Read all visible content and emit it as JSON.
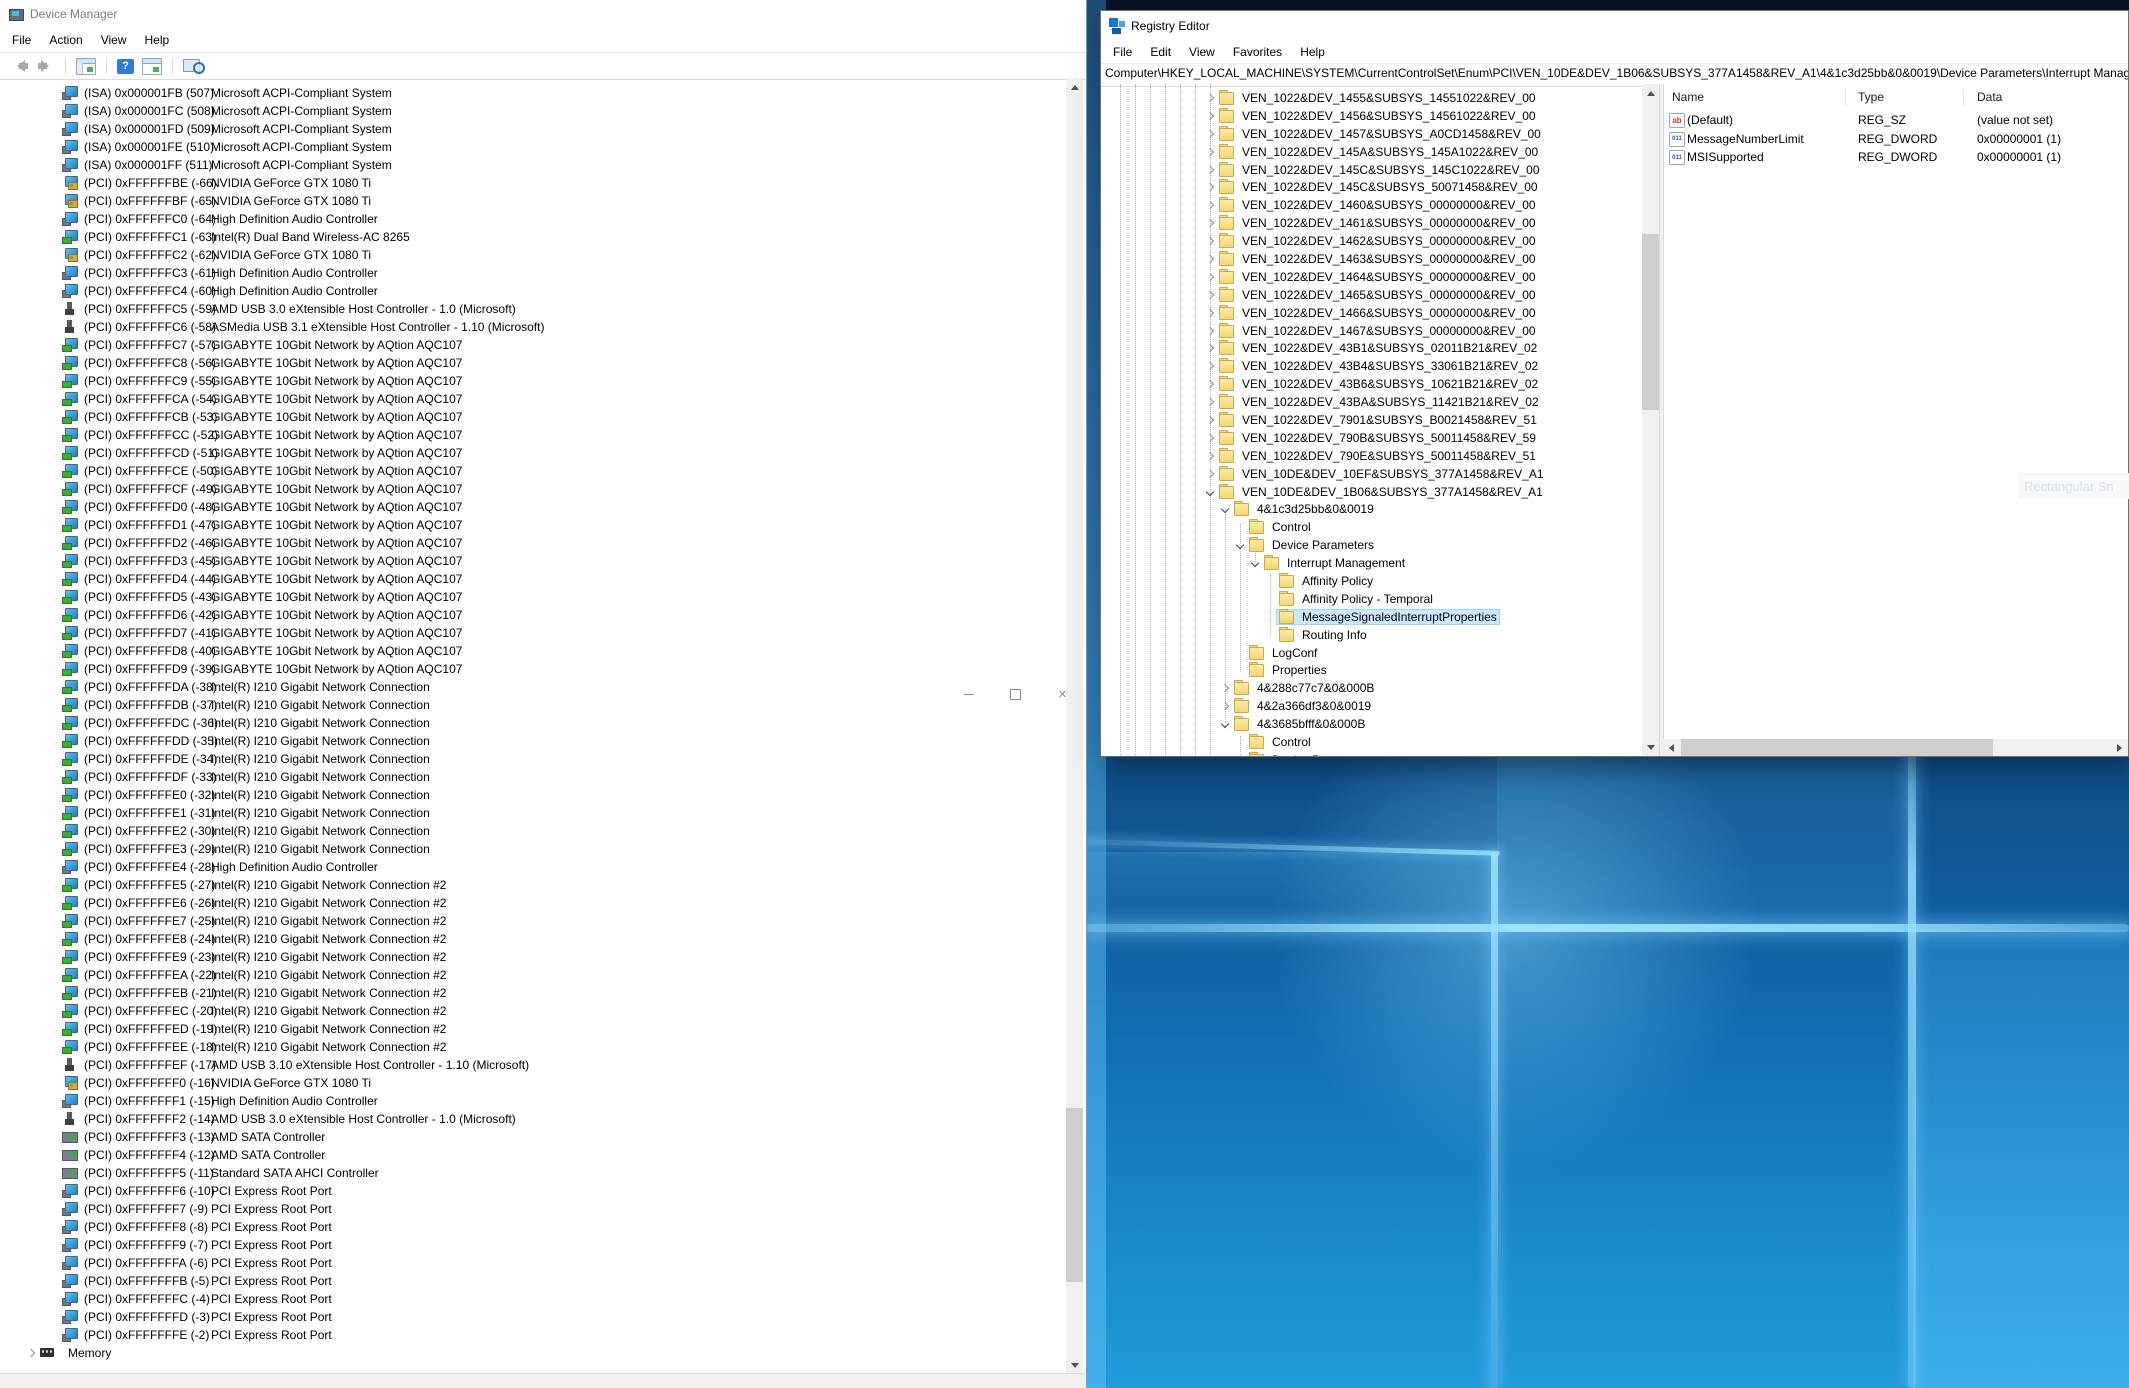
{
  "colors": {
    "selection": "#cce8ff",
    "folder": "#f6d672",
    "beam": "#9fe0ff",
    "wallpaper_top": "#061124",
    "wallpaper_bottom": "#219bdb",
    "chrome": "#ffffff"
  },
  "ghost": {
    "label": "Rectangular Sn"
  },
  "device_manager": {
    "title": "Device Manager",
    "menus": [
      "File",
      "Action",
      "View",
      "Help"
    ],
    "toolbar_icons": [
      "back",
      "forward",
      "show-console-tree",
      "help",
      "properties",
      "scan-hardware-changes"
    ],
    "memory_label": "Memory",
    "rows": [
      {
        "icon": "system",
        "id": "(ISA) 0x000001FB (507)",
        "name": "Microsoft ACPI-Compliant System"
      },
      {
        "icon": "system",
        "id": "(ISA) 0x000001FC (508)",
        "name": "Microsoft ACPI-Compliant System"
      },
      {
        "icon": "system",
        "id": "(ISA) 0x000001FD (509)",
        "name": "Microsoft ACPI-Compliant System"
      },
      {
        "icon": "system",
        "id": "(ISA) 0x000001FE (510)",
        "name": "Microsoft ACPI-Compliant System"
      },
      {
        "icon": "system",
        "id": "(ISA) 0x000001FF (511)",
        "name": "Microsoft ACPI-Compliant System"
      },
      {
        "icon": "gpu",
        "id": "(PCI) 0xFFFFFFBE (-66)",
        "name": "NVIDIA GeForce GTX 1080 Ti"
      },
      {
        "icon": "gpu",
        "id": "(PCI) 0xFFFFFFBF (-65)",
        "name": "NVIDIA GeForce GTX 1080 Ti"
      },
      {
        "icon": "system",
        "id": "(PCI) 0xFFFFFFC0 (-64)",
        "name": "High Definition Audio Controller"
      },
      {
        "icon": "network",
        "id": "(PCI) 0xFFFFFFC1 (-63)",
        "name": "Intel(R) Dual Band Wireless-AC 8265"
      },
      {
        "icon": "gpu",
        "id": "(PCI) 0xFFFFFFC2 (-62)",
        "name": "NVIDIA GeForce GTX 1080 Ti"
      },
      {
        "icon": "system",
        "id": "(PCI) 0xFFFFFFC3 (-61)",
        "name": "High Definition Audio Controller"
      },
      {
        "icon": "system",
        "id": "(PCI) 0xFFFFFFC4 (-60)",
        "name": "High Definition Audio Controller"
      },
      {
        "icon": "usb",
        "id": "(PCI) 0xFFFFFFC5 (-59)",
        "name": "AMD USB 3.0 eXtensible Host Controller - 1.0 (Microsoft)"
      },
      {
        "icon": "usb",
        "id": "(PCI) 0xFFFFFFC6 (-58)",
        "name": "ASMedia USB 3.1 eXtensible Host Controller - 1.10 (Microsoft)"
      },
      {
        "icon": "network",
        "id": "(PCI) 0xFFFFFFC7 (-57)",
        "name": "GIGABYTE 10Gbit Network by AQtion AQC107"
      },
      {
        "icon": "network",
        "id": "(PCI) 0xFFFFFFC8 (-56)",
        "name": "GIGABYTE 10Gbit Network by AQtion AQC107"
      },
      {
        "icon": "network",
        "id": "(PCI) 0xFFFFFFC9 (-55)",
        "name": "GIGABYTE 10Gbit Network by AQtion AQC107"
      },
      {
        "icon": "network",
        "id": "(PCI) 0xFFFFFFCA (-54)",
        "name": "GIGABYTE 10Gbit Network by AQtion AQC107"
      },
      {
        "icon": "network",
        "id": "(PCI) 0xFFFFFFCB (-53)",
        "name": "GIGABYTE 10Gbit Network by AQtion AQC107"
      },
      {
        "icon": "network",
        "id": "(PCI) 0xFFFFFFCC (-52)",
        "name": "GIGABYTE 10Gbit Network by AQtion AQC107"
      },
      {
        "icon": "network",
        "id": "(PCI) 0xFFFFFFCD (-51)",
        "name": "GIGABYTE 10Gbit Network by AQtion AQC107"
      },
      {
        "icon": "network",
        "id": "(PCI) 0xFFFFFFCE (-50)",
        "name": "GIGABYTE 10Gbit Network by AQtion AQC107"
      },
      {
        "icon": "network",
        "id": "(PCI) 0xFFFFFFCF (-49)",
        "name": "GIGABYTE 10Gbit Network by AQtion AQC107"
      },
      {
        "icon": "network",
        "id": "(PCI) 0xFFFFFFD0 (-48)",
        "name": "GIGABYTE 10Gbit Network by AQtion AQC107"
      },
      {
        "icon": "network",
        "id": "(PCI) 0xFFFFFFD1 (-47)",
        "name": "GIGABYTE 10Gbit Network by AQtion AQC107"
      },
      {
        "icon": "network",
        "id": "(PCI) 0xFFFFFFD2 (-46)",
        "name": "GIGABYTE 10Gbit Network by AQtion AQC107"
      },
      {
        "icon": "network",
        "id": "(PCI) 0xFFFFFFD3 (-45)",
        "name": "GIGABYTE 10Gbit Network by AQtion AQC107"
      },
      {
        "icon": "network",
        "id": "(PCI) 0xFFFFFFD4 (-44)",
        "name": "GIGABYTE 10Gbit Network by AQtion AQC107"
      },
      {
        "icon": "network",
        "id": "(PCI) 0xFFFFFFD5 (-43)",
        "name": "GIGABYTE 10Gbit Network by AQtion AQC107"
      },
      {
        "icon": "network",
        "id": "(PCI) 0xFFFFFFD6 (-42)",
        "name": "GIGABYTE 10Gbit Network by AQtion AQC107"
      },
      {
        "icon": "network",
        "id": "(PCI) 0xFFFFFFD7 (-41)",
        "name": "GIGABYTE 10Gbit Network by AQtion AQC107"
      },
      {
        "icon": "network",
        "id": "(PCI) 0xFFFFFFD8 (-40)",
        "name": "GIGABYTE 10Gbit Network by AQtion AQC107"
      },
      {
        "icon": "network",
        "id": "(PCI) 0xFFFFFFD9 (-39)",
        "name": "GIGABYTE 10Gbit Network by AQtion AQC107"
      },
      {
        "icon": "network",
        "id": "(PCI) 0xFFFFFFDA (-38)",
        "name": "Intel(R) I210 Gigabit Network Connection"
      },
      {
        "icon": "network",
        "id": "(PCI) 0xFFFFFFDB (-37)",
        "name": "Intel(R) I210 Gigabit Network Connection"
      },
      {
        "icon": "network",
        "id": "(PCI) 0xFFFFFFDC (-36)",
        "name": "Intel(R) I210 Gigabit Network Connection"
      },
      {
        "icon": "network",
        "id": "(PCI) 0xFFFFFFDD (-35)",
        "name": "Intel(R) I210 Gigabit Network Connection"
      },
      {
        "icon": "network",
        "id": "(PCI) 0xFFFFFFDE (-34)",
        "name": "Intel(R) I210 Gigabit Network Connection"
      },
      {
        "icon": "network",
        "id": "(PCI) 0xFFFFFFDF (-33)",
        "name": "Intel(R) I210 Gigabit Network Connection"
      },
      {
        "icon": "network",
        "id": "(PCI) 0xFFFFFFE0 (-32)",
        "name": "Intel(R) I210 Gigabit Network Connection"
      },
      {
        "icon": "network",
        "id": "(PCI) 0xFFFFFFE1 (-31)",
        "name": "Intel(R) I210 Gigabit Network Connection"
      },
      {
        "icon": "network",
        "id": "(PCI) 0xFFFFFFE2 (-30)",
        "name": "Intel(R) I210 Gigabit Network Connection"
      },
      {
        "icon": "network",
        "id": "(PCI) 0xFFFFFFE3 (-29)",
        "name": "Intel(R) I210 Gigabit Network Connection"
      },
      {
        "icon": "system",
        "id": "(PCI) 0xFFFFFFE4 (-28)",
        "name": "High Definition Audio Controller"
      },
      {
        "icon": "network",
        "id": "(PCI) 0xFFFFFFE5 (-27)",
        "name": "Intel(R) I210 Gigabit Network Connection #2"
      },
      {
        "icon": "network",
        "id": "(PCI) 0xFFFFFFE6 (-26)",
        "name": "Intel(R) I210 Gigabit Network Connection #2"
      },
      {
        "icon": "network",
        "id": "(PCI) 0xFFFFFFE7 (-25)",
        "name": "Intel(R) I210 Gigabit Network Connection #2"
      },
      {
        "icon": "network",
        "id": "(PCI) 0xFFFFFFE8 (-24)",
        "name": "Intel(R) I210 Gigabit Network Connection #2"
      },
      {
        "icon": "network",
        "id": "(PCI) 0xFFFFFFE9 (-23)",
        "name": "Intel(R) I210 Gigabit Network Connection #2"
      },
      {
        "icon": "network",
        "id": "(PCI) 0xFFFFFFEA (-22)",
        "name": "Intel(R) I210 Gigabit Network Connection #2"
      },
      {
        "icon": "network",
        "id": "(PCI) 0xFFFFFFEB (-21)",
        "name": "Intel(R) I210 Gigabit Network Connection #2"
      },
      {
        "icon": "network",
        "id": "(PCI) 0xFFFFFFEC (-20)",
        "name": "Intel(R) I210 Gigabit Network Connection #2"
      },
      {
        "icon": "network",
        "id": "(PCI) 0xFFFFFFED (-19)",
        "name": "Intel(R) I210 Gigabit Network Connection #2"
      },
      {
        "icon": "network",
        "id": "(PCI) 0xFFFFFFEE (-18)",
        "name": "Intel(R) I210 Gigabit Network Connection #2"
      },
      {
        "icon": "usb",
        "id": "(PCI) 0xFFFFFFEF (-17)",
        "name": "AMD USB 3.10 eXtensible Host Controller - 1.10 (Microsoft)"
      },
      {
        "icon": "gpu",
        "id": "(PCI) 0xFFFFFFF0 (-16)",
        "name": "NVIDIA GeForce GTX 1080 Ti"
      },
      {
        "icon": "system",
        "id": "(PCI) 0xFFFFFFF1 (-15)",
        "name": "High Definition Audio Controller"
      },
      {
        "icon": "usb",
        "id": "(PCI) 0xFFFFFFF2 (-14)",
        "name": "AMD USB 3.0 eXtensible Host Controller - 1.0 (Microsoft)"
      },
      {
        "icon": "sata",
        "id": "(PCI) 0xFFFFFFF3 (-13)",
        "name": "AMD SATA Controller"
      },
      {
        "icon": "sata",
        "id": "(PCI) 0xFFFFFFF4 (-12)",
        "name": "AMD SATA Controller"
      },
      {
        "icon": "sata",
        "id": "(PCI) 0xFFFFFFF5 (-11)",
        "name": "Standard SATA AHCI Controller"
      },
      {
        "icon": "system",
        "id": "(PCI) 0xFFFFFFF6 (-10)",
        "name": "PCI Express Root Port"
      },
      {
        "icon": "system",
        "id": "(PCI) 0xFFFFFFF7 (-9)",
        "name": "PCI Express Root Port"
      },
      {
        "icon": "system",
        "id": "(PCI) 0xFFFFFFF8 (-8)",
        "name": "PCI Express Root Port"
      },
      {
        "icon": "system",
        "id": "(PCI) 0xFFFFFFF9 (-7)",
        "name": "PCI Express Root Port"
      },
      {
        "icon": "system",
        "id": "(PCI) 0xFFFFFFFA (-6)",
        "name": "PCI Express Root Port"
      },
      {
        "icon": "system",
        "id": "(PCI) 0xFFFFFFFB (-5)",
        "name": "PCI Express Root Port"
      },
      {
        "icon": "system",
        "id": "(PCI) 0xFFFFFFFC (-4)",
        "name": "PCI Express Root Port"
      },
      {
        "icon": "system",
        "id": "(PCI) 0xFFFFFFFD (-3)",
        "name": "PCI Express Root Port"
      },
      {
        "icon": "system",
        "id": "(PCI) 0xFFFFFFFE (-2)",
        "name": "PCI Express Root Port"
      }
    ]
  },
  "registry_editor": {
    "title": "Registry Editor",
    "menus": [
      "File",
      "Edit",
      "View",
      "Favorites",
      "Help"
    ],
    "address": "Computer\\HKEY_LOCAL_MACHINE\\SYSTEM\\CurrentControlSet\\Enum\\PCI\\VEN_10DE&DEV_1B06&SUBSYS_377A1458&REV_A1\\4&1c3d25bb&0&0019\\Device Parameters\\Interrupt Management\\MessageSignaledInterruptProperties",
    "tree": [
      {
        "label": "VEN_1022&DEV_1455&SUBSYS_14551022&REV_00",
        "level": 0,
        "twisty": "right"
      },
      {
        "label": "VEN_1022&DEV_1456&SUBSYS_14561022&REV_00",
        "level": 0,
        "twisty": "right"
      },
      {
        "label": "VEN_1022&DEV_1457&SUBSYS_A0CD1458&REV_00",
        "level": 0,
        "twisty": "right"
      },
      {
        "label": "VEN_1022&DEV_145A&SUBSYS_145A1022&REV_00",
        "level": 0,
        "twisty": "right"
      },
      {
        "label": "VEN_1022&DEV_145C&SUBSYS_145C1022&REV_00",
        "level": 0,
        "twisty": "right"
      },
      {
        "label": "VEN_1022&DEV_145C&SUBSYS_50071458&REV_00",
        "level": 0,
        "twisty": "right"
      },
      {
        "label": "VEN_1022&DEV_1460&SUBSYS_00000000&REV_00",
        "level": 0,
        "twisty": "right"
      },
      {
        "label": "VEN_1022&DEV_1461&SUBSYS_00000000&REV_00",
        "level": 0,
        "twisty": "right"
      },
      {
        "label": "VEN_1022&DEV_1462&SUBSYS_00000000&REV_00",
        "level": 0,
        "twisty": "right"
      },
      {
        "label": "VEN_1022&DEV_1463&SUBSYS_00000000&REV_00",
        "level": 0,
        "twisty": "right"
      },
      {
        "label": "VEN_1022&DEV_1464&SUBSYS_00000000&REV_00",
        "level": 0,
        "twisty": "right"
      },
      {
        "label": "VEN_1022&DEV_1465&SUBSYS_00000000&REV_00",
        "level": 0,
        "twisty": "right"
      },
      {
        "label": "VEN_1022&DEV_1466&SUBSYS_00000000&REV_00",
        "level": 0,
        "twisty": "right"
      },
      {
        "label": "VEN_1022&DEV_1467&SUBSYS_00000000&REV_00",
        "level": 0,
        "twisty": "right"
      },
      {
        "label": "VEN_1022&DEV_43B1&SUBSYS_02011B21&REV_02",
        "level": 0,
        "twisty": "right"
      },
      {
        "label": "VEN_1022&DEV_43B4&SUBSYS_33061B21&REV_02",
        "level": 0,
        "twisty": "right"
      },
      {
        "label": "VEN_1022&DEV_43B6&SUBSYS_10621B21&REV_02",
        "level": 0,
        "twisty": "right"
      },
      {
        "label": "VEN_1022&DEV_43BA&SUBSYS_11421B21&REV_02",
        "level": 0,
        "twisty": "right"
      },
      {
        "label": "VEN_1022&DEV_7901&SUBSYS_B0021458&REV_51",
        "level": 0,
        "twisty": "right"
      },
      {
        "label": "VEN_1022&DEV_790B&SUBSYS_50011458&REV_59",
        "level": 0,
        "twisty": "right"
      },
      {
        "label": "VEN_1022&DEV_790E&SUBSYS_50011458&REV_51",
        "level": 0,
        "twisty": "right"
      },
      {
        "label": "VEN_10DE&DEV_10EF&SUBSYS_377A1458&REV_A1",
        "level": 0,
        "twisty": "right"
      },
      {
        "label": "VEN_10DE&DEV_1B06&SUBSYS_377A1458&REV_A1",
        "level": 0,
        "twisty": "down"
      },
      {
        "label": "4&1c3d25bb&0&0019",
        "level": 1,
        "twisty": "down"
      },
      {
        "label": "Control",
        "level": 2,
        "twisty": "none"
      },
      {
        "label": "Device Parameters",
        "level": 2,
        "twisty": "down"
      },
      {
        "label": "Interrupt Management",
        "level": 3,
        "twisty": "down"
      },
      {
        "label": "Affinity Policy",
        "level": 4,
        "twisty": "none"
      },
      {
        "label": "Affinity Policy - Temporal",
        "level": 4,
        "twisty": "none"
      },
      {
        "label": "MessageSignaledInterruptProperties",
        "level": 4,
        "twisty": "none",
        "selected": true
      },
      {
        "label": "Routing Info",
        "level": 4,
        "twisty": "none"
      },
      {
        "label": "LogConf",
        "level": 2,
        "twisty": "none"
      },
      {
        "label": "Properties",
        "level": 2,
        "twisty": "none"
      },
      {
        "label": "4&288c77c7&0&000B",
        "level": 1,
        "twisty": "right"
      },
      {
        "label": "4&2a366df3&0&0019",
        "level": 1,
        "twisty": "right"
      },
      {
        "label": "4&3685bfff&0&000B",
        "level": 1,
        "twisty": "down"
      },
      {
        "label": "Control",
        "level": 2,
        "twisty": "none"
      },
      {
        "label": "Device Parameters",
        "level": 2,
        "twisty": "none"
      }
    ],
    "values": {
      "columns": [
        "Name",
        "Type",
        "Data"
      ],
      "rows": [
        {
          "icon": "sz",
          "name": "(Default)",
          "type": "REG_SZ",
          "data": "(value not set)"
        },
        {
          "icon": "dword",
          "name": "MessageNumberLimit",
          "type": "REG_DWORD",
          "data": "0x00000001 (1)"
        },
        {
          "icon": "dword",
          "name": "MSISupported",
          "type": "REG_DWORD",
          "data": "0x00000001 (1)"
        }
      ]
    }
  }
}
